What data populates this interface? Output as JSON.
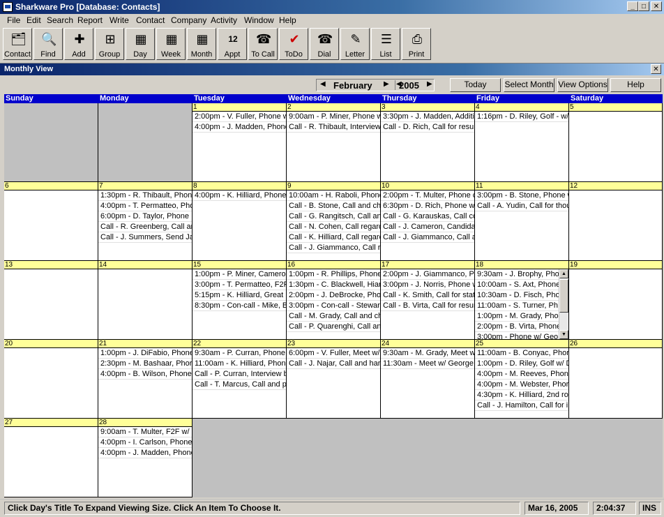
{
  "window": {
    "title": "Sharkware Pro  [Database: Contacts]",
    "min": "_",
    "max": "□",
    "close": "✕"
  },
  "menu": [
    "File",
    "Edit",
    "Search",
    "Report",
    "Write",
    "Contact",
    "Company",
    "Activity",
    "Window",
    "Help"
  ],
  "toolbar": [
    {
      "label": "Contact",
      "icon": "contact-icon",
      "glyph": "🗂"
    },
    {
      "label": "Find",
      "icon": "magnifier-icon",
      "glyph": "🔍"
    },
    {
      "label": "Add",
      "icon": "add-contact-icon",
      "glyph": "✚"
    },
    {
      "label": "Group",
      "icon": "group-icon",
      "glyph": "⊞"
    },
    {
      "label": "Day",
      "icon": "day-calendar-icon",
      "glyph": "▦"
    },
    {
      "label": "Week",
      "icon": "week-calendar-icon",
      "glyph": "▦"
    },
    {
      "label": "Month",
      "icon": "month-calendar-icon",
      "glyph": "▦"
    },
    {
      "label": "Appt",
      "icon": "appointment-icon",
      "glyph": "12"
    },
    {
      "label": "To Call",
      "icon": "to-call-icon",
      "glyph": "☎"
    },
    {
      "label": "ToDo",
      "icon": "checkmark-icon",
      "glyph": "✔"
    },
    {
      "label": "Dial",
      "icon": "telephone-icon",
      "glyph": "☎"
    },
    {
      "label": "Letter",
      "icon": "letter-icon",
      "glyph": "✎"
    },
    {
      "label": "List",
      "icon": "list-icon",
      "glyph": "☰"
    },
    {
      "label": "Print",
      "icon": "printer-icon",
      "glyph": "⎙"
    }
  ],
  "child_window": {
    "title": "Monthly View",
    "close": "✕"
  },
  "nav": {
    "month": "February",
    "year": "2005",
    "prev_arrow": "◀",
    "next_arrow": "▶",
    "buttons": [
      "Today",
      "Select Month",
      "View Options",
      "Help"
    ]
  },
  "weekdays": [
    "Sunday",
    "Monday",
    "Tuesday",
    "Wednesday",
    "Thursday",
    "Friday",
    "Saturday"
  ],
  "weeks": [
    [
      {
        "day": "",
        "items": []
      },
      {
        "day": "",
        "items": []
      },
      {
        "day": "1",
        "items": [
          "2:00pm - V. Fuller, Phone w/",
          "4:00pm - J. Madden, Phone"
        ]
      },
      {
        "day": "2",
        "items": [
          "9:00am - P. Miner, Phone w/",
          "Call - R. Thibault, Interview"
        ]
      },
      {
        "day": "3",
        "items": [
          "3:30pm - J. Madden, Additi",
          "Call - D. Rich, Call for resum"
        ]
      },
      {
        "day": "4",
        "items": [
          "1:16pm - D. Riley, Golf - w/"
        ]
      },
      {
        "day": "5",
        "items": []
      }
    ],
    [
      {
        "day": "6",
        "items": []
      },
      {
        "day": "7",
        "items": [
          "1:30pm - R. Thibault, Phon",
          "4:00pm - T. Permatteo, Pho",
          "6:00pm - D. Taylor, Phone",
          "Call - R. Greenberg, Call and",
          "Call - J. Summers, Send Jan"
        ]
      },
      {
        "day": "8",
        "items": [
          "4:00pm - K. Hilliard, Phone"
        ]
      },
      {
        "day": "9",
        "items": [
          "10:00am - H. Raboli, Phone",
          "Call - B. Stone, Call and chc",
          "Call - G. Rangitsch, Call and",
          "Call - N. Cohen, Call regardir",
          "Call - K. Hilliard, Call regardir",
          "Call - J. Giammanco, Call rec"
        ]
      },
      {
        "day": "10",
        "items": [
          "2:00pm - T. Multer, Phone c",
          "6:30pm - D. Rich, Phone w",
          "Call - G. Karauskas, Call cor",
          "Call - J. Cameron, Candidate",
          "Call - J. Giammanco, Call an"
        ]
      },
      {
        "day": "11",
        "items": [
          "3:00pm - B. Stone, Phone w",
          "Call - A. Yudin, Call for thoug"
        ]
      },
      {
        "day": "12",
        "items": []
      }
    ],
    [
      {
        "day": "13",
        "items": []
      },
      {
        "day": "14",
        "items": []
      },
      {
        "day": "15",
        "items": [
          "1:00pm - P. Miner, Cameron",
          "3:00pm - T. Permatteo, F2F",
          "5:15pm - K. Hilliard, Great F",
          "8:30pm - Con-call - Mike, B"
        ]
      },
      {
        "day": "16",
        "items": [
          "1:00pm - R. Phillips, Phone",
          "1:30pm - C. Blackwell, Hiar",
          "2:00pm - J. DeBrocke, Pho",
          "3:00pm - Con-call - Stewarc",
          "Call - M. Grady, Call and che",
          "Call - P. Quarenghi, Call anc"
        ]
      },
      {
        "day": "17",
        "items": [
          "2:00pm - J. Giammanco, Ph",
          "3:00pm - J. Norris, Phone w",
          "Call - K. Smith, Call for statu",
          "Call - B. Virta, Call for resume"
        ]
      },
      {
        "day": "18",
        "items": [
          "9:30am - J. Brophy, Pho",
          "10:00am - S. Axt, Phone",
          "10:30am - D. Fisch, Pho",
          "11:00am - S. Turner, Ph",
          "1:00pm - M. Grady, Phor",
          "2:00pm - B. Virta, Phone",
          "3:00pm - Phone w/ Geo"
        ],
        "scroll": true
      },
      {
        "day": "19",
        "items": []
      }
    ],
    [
      {
        "day": "20",
        "items": []
      },
      {
        "day": "21",
        "items": [
          "1:00pm - J. DiFabio, Phone",
          "2:30pm - M. Bashaar, Phor",
          "4:00pm - B. Wilson, Phone"
        ]
      },
      {
        "day": "22",
        "items": [
          "9:30am - P. Curran, Phone",
          "11:00am - K. Hilliard, Phone",
          "Call - P. Curran, Interview br",
          "Call - T. Marcus, Call and pil"
        ]
      },
      {
        "day": "23",
        "items": [
          "6:00pm - V. Fuller, Meet w/",
          "Call - J. Najar, Call and hard"
        ]
      },
      {
        "day": "24",
        "items": [
          "9:30am - M. Grady, Meet w",
          "11:30am - Meet w/ George"
        ]
      },
      {
        "day": "25",
        "items": [
          "11:00am - B. Conyac, Phor",
          "1:00pm - D. Riley, Golf w/ D",
          "4:00pm - M. Reeves, Phon",
          "4:00pm - M. Webster, Phor",
          "4:30pm - K. Hilliard, 2nd rou",
          "Call - J. Hamilton, Call for int"
        ]
      },
      {
        "day": "26",
        "items": []
      }
    ],
    [
      {
        "day": "27",
        "items": []
      },
      {
        "day": "28",
        "items": [
          "9:00am - T. Multer, F2F w/",
          "4:00pm - I. Carlson, Phone",
          "4:00pm - J. Madden, Phone"
        ]
      },
      {
        "day": "",
        "items": []
      },
      {
        "day": "",
        "items": []
      },
      {
        "day": "",
        "items": []
      },
      {
        "day": "",
        "items": []
      },
      {
        "day": "",
        "items": []
      }
    ]
  ],
  "status": {
    "hint": "Click Day's Title To Expand Viewing Size.  Click An Item To Choose It.",
    "date": "Mar 16, 2005",
    "time": "2:04:37",
    "mode": "INS"
  },
  "colors": {
    "header_blue": "#0000cc",
    "daynum_yellow": "#ffff99",
    "todo_check_red": "#cc0000"
  }
}
